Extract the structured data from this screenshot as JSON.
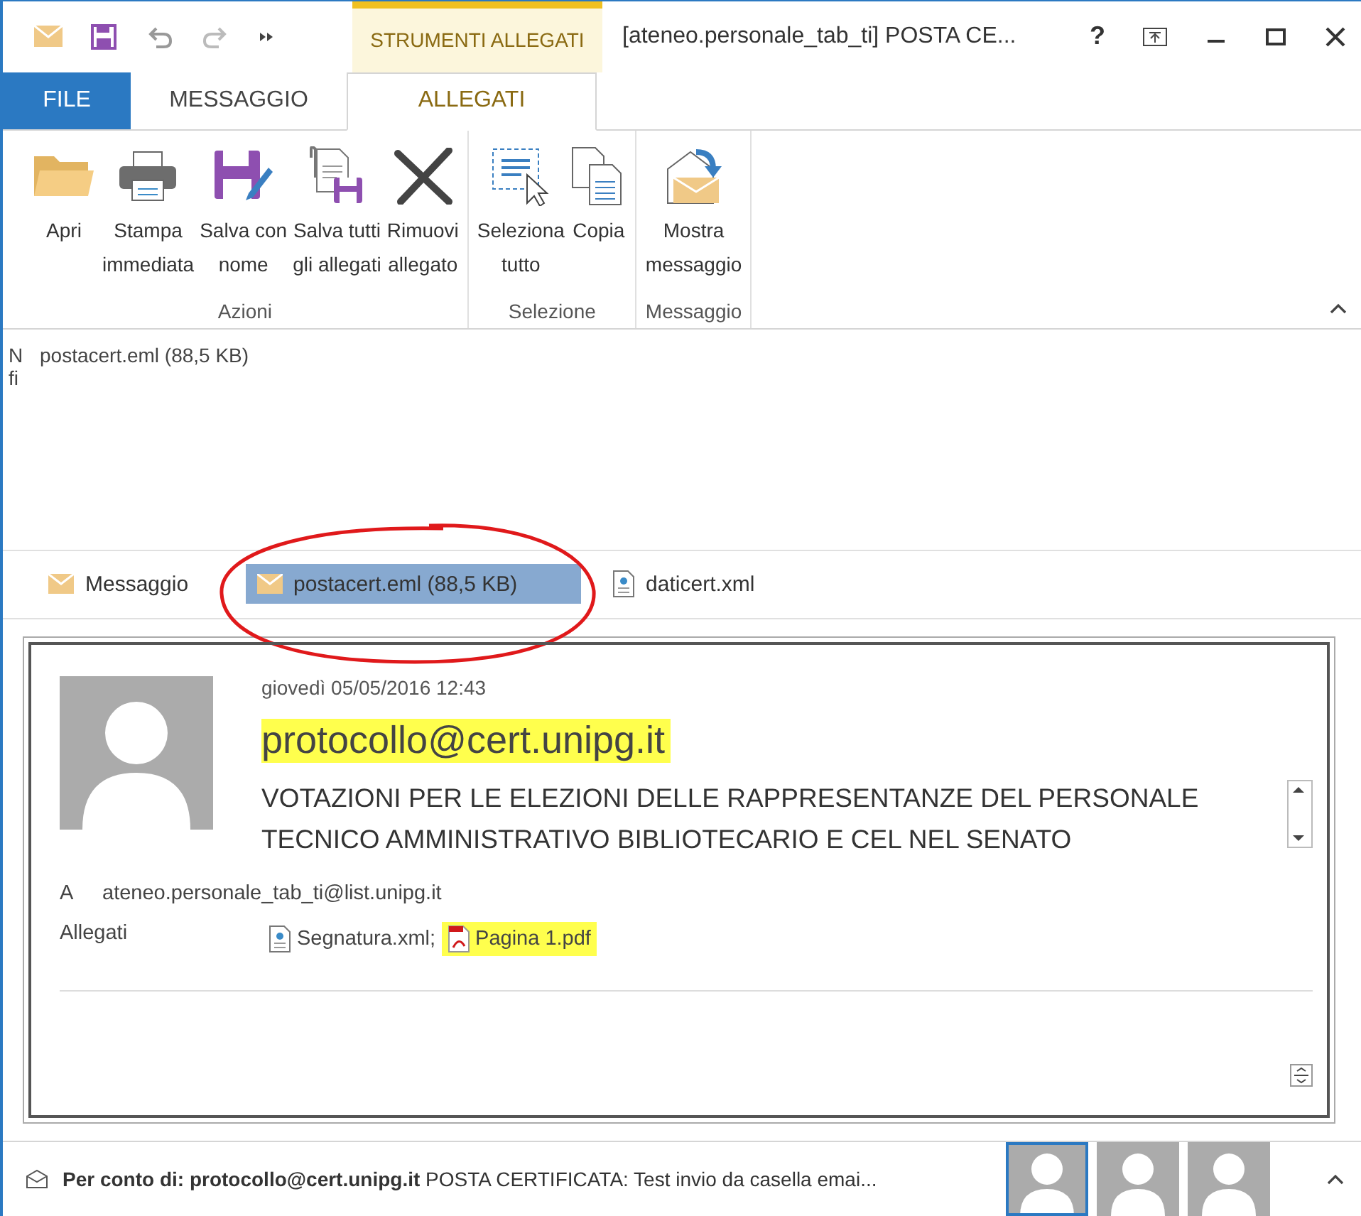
{
  "window": {
    "title": "[ateneo.personale_tab_ti] POSTA CE...",
    "context_group": "STRUMENTI ALLEGATI",
    "help": "?"
  },
  "tabs": [
    {
      "label": "FILE",
      "kind": "file",
      "selected": false
    },
    {
      "label": "MESSAGGIO",
      "kind": "normal",
      "selected": false
    },
    {
      "label": "ALLEGATI",
      "kind": "context",
      "selected": true
    }
  ],
  "ribbon_groups": [
    {
      "label": "Azioni",
      "buttons": [
        {
          "lines": [
            "Apri"
          ],
          "kind": "folder"
        },
        {
          "lines": [
            "Stampa",
            "immediata"
          ],
          "kind": "printer"
        },
        {
          "lines": [
            "Salva con",
            "nome"
          ],
          "kind": "saveas"
        },
        {
          "lines": [
            "Salva tutti",
            "gli allegati"
          ],
          "kind": "saveall"
        },
        {
          "lines": [
            "Rimuovi",
            "allegato"
          ],
          "kind": "remove"
        }
      ]
    },
    {
      "label": "Selezione",
      "buttons": [
        {
          "lines": [
            "Seleziona",
            "tutto"
          ],
          "kind": "select"
        },
        {
          "lines": [
            "Copia"
          ],
          "kind": "copy"
        }
      ]
    },
    {
      "label": "Messaggio",
      "buttons": [
        {
          "lines": [
            "Mostra",
            "messaggio"
          ],
          "kind": "show"
        }
      ]
    }
  ],
  "preview_info": {
    "cut_lines": [
      "N",
      "fi"
    ],
    "file": "postacert.eml (88,5 KB)"
  },
  "attachment_bar": [
    {
      "label": "Messaggio",
      "kind": "mail",
      "selected": false
    },
    {
      "label": "postacert.eml (88,5 KB)",
      "kind": "mail",
      "selected": true
    },
    {
      "label": "daticert.xml",
      "kind": "xml",
      "selected": false
    }
  ],
  "message": {
    "date": "giovedì 05/05/2016 12:43",
    "sender": "protocollo@cert.unipg.it",
    "subject": "VOTAZIONI PER LE ELEZIONI DELLE RAPPRESENTANZE DEL PERSONALE TECNICO AMMINISTRATIVO BIBLIOTECARIO E CEL NEL SENATO",
    "to_label": "A",
    "to": "ateneo.personale_tab_ti@list.unipg.it",
    "attachments_label": "Allegati",
    "attachments": [
      {
        "name": "Segnatura.xml;",
        "kind": "xml",
        "highlighted": false
      },
      {
        "name": "Pagina 1.pdf",
        "kind": "pdf",
        "highlighted": true
      }
    ]
  },
  "people_pane": {
    "text": "**Per conto di: protocollo@cert.unipg.it** POSTA CERTIFICATA: Test invio da casella emai...",
    "avatars": [
      {
        "selected": true
      },
      {
        "selected": false
      },
      {
        "selected": false
      }
    ]
  }
}
